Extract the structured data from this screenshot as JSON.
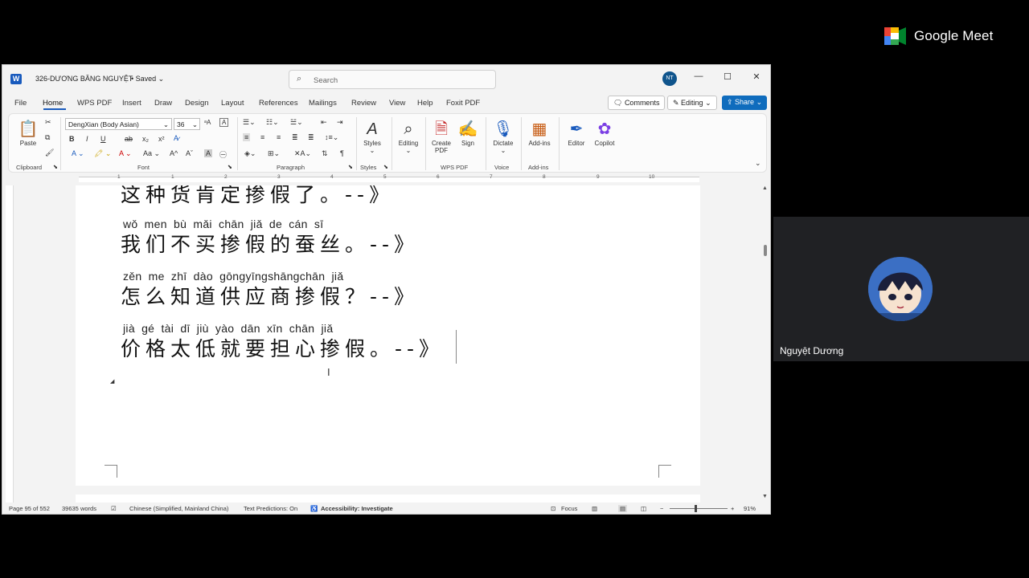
{
  "meet": {
    "brand": "Google Meet",
    "participant_name": "Nguyệt Dương"
  },
  "window": {
    "doc_title": "326-DƯƠNG BĂNG NGUYỆT",
    "saved": "• Saved ⌄",
    "search_placeholder": "Search",
    "user_initials": "NT"
  },
  "tabs": [
    "File",
    "Home",
    "WPS PDF",
    "Insert",
    "Draw",
    "Design",
    "Layout",
    "References",
    "Mailings",
    "Review",
    "View",
    "Help",
    "Foxit PDF"
  ],
  "topbar": {
    "comments": "Comments",
    "editing": "Editing",
    "share": "Share"
  },
  "ribbon": {
    "paste": "Paste",
    "font_name": "DengXian (Body Asian)",
    "font_size": "36",
    "styles": "Styles",
    "editing": "Editing",
    "create_pdf": "Create PDF",
    "sign": "Sign",
    "dictate": "Dictate",
    "addins": "Add-ins",
    "editor": "Editor",
    "copilot": "Copilot",
    "groups": {
      "clipboard": "Clipboard",
      "font": "Font",
      "paragraph": "Paragraph",
      "styles": "Styles",
      "wps_pdf": "WPS PDF",
      "voice": "Voice",
      "addins": "Add-ins"
    }
  },
  "ruler": {
    "numbers": [
      "1",
      "1",
      "2",
      "3",
      "4",
      "5",
      "6",
      "7",
      "8",
      "9",
      "10"
    ]
  },
  "document": {
    "partial_line": "这种货肯定掺假了。--》",
    "lines": [
      {
        "pinyin": "wǒ men bù mǎi chān jiǎ de cán sī",
        "hanzi": "我们不买掺假的蚕丝。--》"
      },
      {
        "pinyin": "zěn me zhī dào gōngyīngshāngchān jiǎ",
        "hanzi": "怎么知道供应商掺假？--》"
      },
      {
        "pinyin": "jià gé tài dī jiù yào dān xīn chān jiǎ",
        "hanzi": "价格太低就要担心掺假。--》"
      }
    ]
  },
  "status": {
    "page": "Page 95 of 552",
    "words": "39635 words",
    "language": "Chinese (Simplified, Mainland China)",
    "predictions": "Text Predictions: On",
    "accessibility": "Accessibility: Investigate",
    "focus": "Focus",
    "zoom": "91%"
  }
}
